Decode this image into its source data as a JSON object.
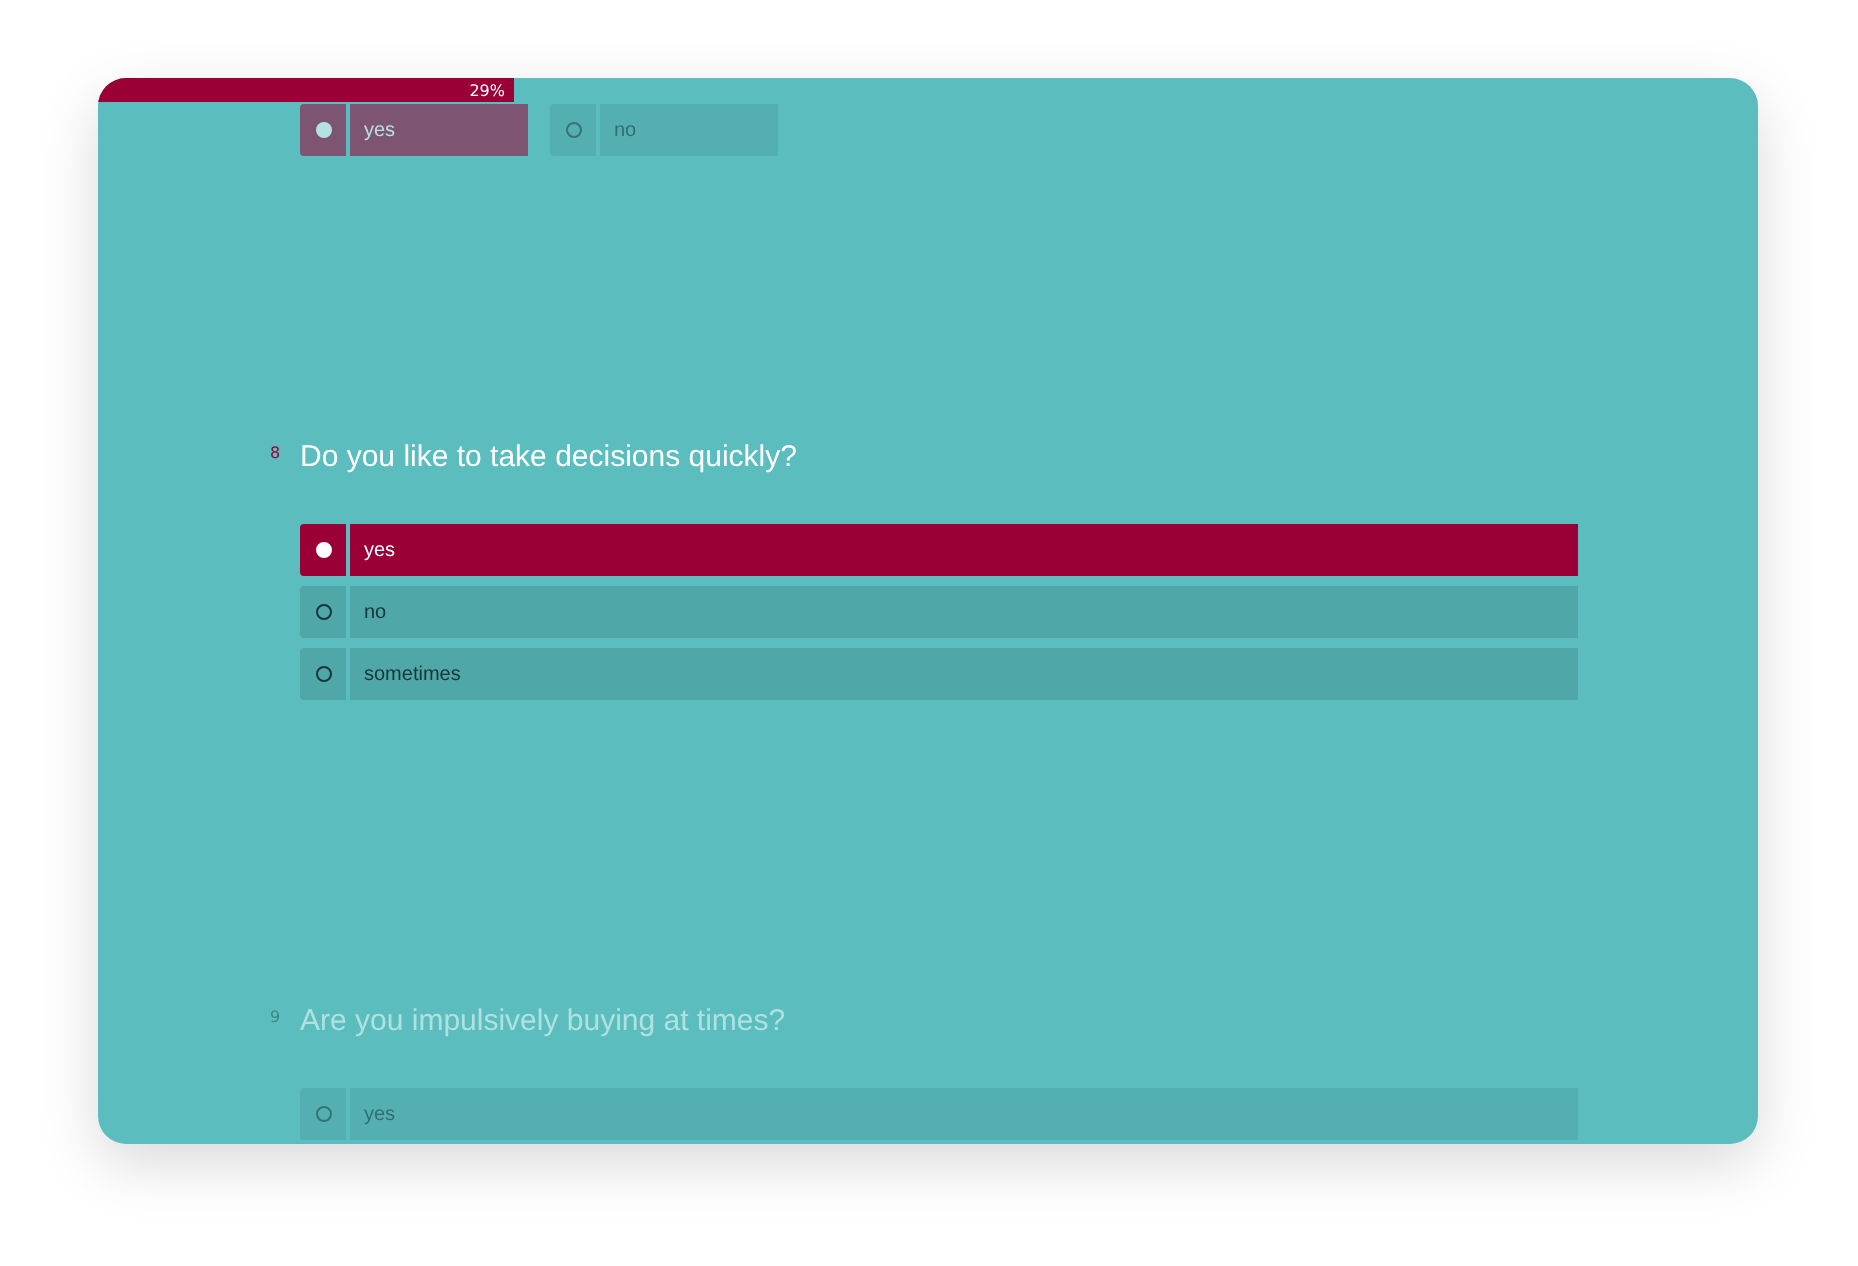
{
  "progress": {
    "label": "29%",
    "level": 0.25
  },
  "questions": [
    {
      "active": false,
      "kind": "inline",
      "options": [
        {
          "label": "yes",
          "selected": true
        },
        {
          "label": "no",
          "selected": false
        }
      ]
    },
    {
      "active": true,
      "kind": "stacked",
      "number": "8",
      "title": "Do you like to take decisions quickly?",
      "options": [
        {
          "label": "yes",
          "selected": true
        },
        {
          "label": "no",
          "selected": false
        },
        {
          "label": "sometimes",
          "selected": false
        }
      ]
    },
    {
      "active": false,
      "kind": "stacked",
      "number": "9",
      "title": "Are you impulsively buying at times?",
      "options": [
        {
          "label": "yes",
          "selected": false
        }
      ]
    }
  ]
}
